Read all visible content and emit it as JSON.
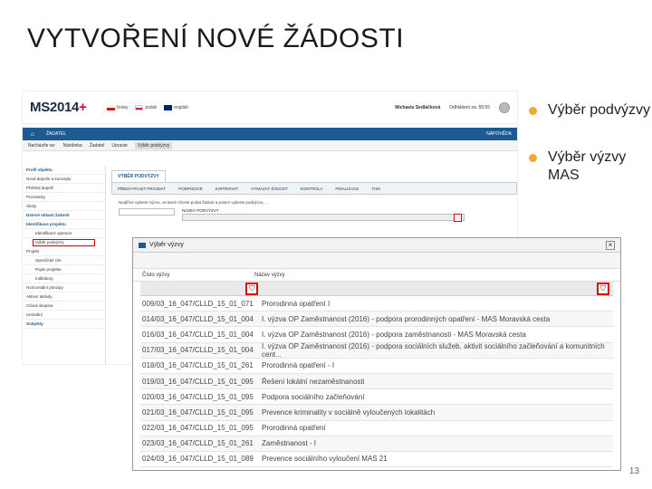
{
  "slide": {
    "title": "VYTVOŘENÍ NOVÉ ŽÁDOSTI",
    "page_number": "13",
    "bullets": [
      "Výběr podvýzvy",
      "Výběr výzvy MAS"
    ]
  },
  "app": {
    "logo_main": "MS2014",
    "logo_plus": "+",
    "languages": [
      "česky",
      "polski",
      "english"
    ],
    "user_name": "Michaela Sedláčková",
    "session_label": "Odhlášení za: 55:55",
    "nav_left": "ŽADATEL",
    "nav_help": "NÁPOVĚDA",
    "breadcrumbs": [
      "Nacházíte se:",
      "Nástěnka",
      "Žadatel",
      "Upravte",
      "Výběr podvýzvy"
    ],
    "sidebar": [
      {
        "label": "Profil objektu",
        "type": "head"
      },
      {
        "label": "Nová depeše a koncepty",
        "type": "item"
      },
      {
        "label": "Přehled depeší",
        "type": "item"
      },
      {
        "label": "Poznámky",
        "type": "item"
      },
      {
        "label": "Úkoly",
        "type": "item"
      },
      {
        "label": "Datové oblasti žádosti",
        "type": "head"
      },
      {
        "label": "Identifikace projektu",
        "type": "head"
      },
      {
        "label": "Identifikace operace",
        "type": "sub"
      },
      {
        "label": "Výběr podvýzvy",
        "type": "active"
      },
      {
        "label": "Projekt",
        "type": "item"
      },
      {
        "label": "Specifické cíle",
        "type": "sub"
      },
      {
        "label": "Popis projektu",
        "type": "sub"
      },
      {
        "label": "Indikátory",
        "type": "sub"
      },
      {
        "label": "Horizontální principy",
        "type": "item"
      },
      {
        "label": "Aktivní aktivity",
        "type": "item"
      },
      {
        "label": "Cílová skupina",
        "type": "item"
      },
      {
        "label": "Umístění",
        "type": "item"
      },
      {
        "label": "Subjekty",
        "type": "head"
      }
    ],
    "content_tab": "VÝBĚR PODVÝZVY",
    "toolbar": [
      "PŘEDVYPLNIT PROJEKT",
      "PODPISOVÉ",
      "KOPÍROVAT",
      "VYMAZAT ŽÁDOST",
      "KONTROLA",
      "FINALIZACE",
      "TISK"
    ],
    "note": "Nejdříve vyberte výzvu, ve které chcete podat žádost a potom vyberte podvýzvu, ...",
    "field_label": "NÁZEV PODVÝZVY"
  },
  "dialog": {
    "title": "Výběr výzvy",
    "close_icon": "close-icon",
    "col1": "Číslo výzvy",
    "col2": "Název výzvy",
    "rows": [
      [
        "009/03_16_047/CLLD_15_01_071",
        "Prorodinná opatření I"
      ],
      [
        "014/03_16_047/CLLD_15_01_004",
        "I. výzva OP Zaměstnanost (2016) - podpora prorodinných opatření - MAS Moravská cesta"
      ],
      [
        "016/03_16_047/CLLD_15_01_004",
        "I. výzva OP Zaměstnanost (2016) - podpora zaměstnanosti - MAS Moravská cesta"
      ],
      [
        "017/03_16_047/CLLD_15_01_004",
        "I. výzva OP Zaměstnanost (2016) - podpora sociálních služeb, aktivit sociálního začleňování a komunitních cent..."
      ],
      [
        "018/03_16_047/CLLD_15_01_261",
        "Prorodinná opatření - I"
      ],
      [
        "019/03_16_047/CLLD_15_01_095",
        "Řešení lokální nezaměstnanosti"
      ],
      [
        "020/03_16_047/CLLD_15_01_095",
        "Podpora sociálního začleňování"
      ],
      [
        "021/03_16_047/CLLD_15_01_095",
        "Prevence kriminality v sociálně vyloučených lokalitách"
      ],
      [
        "022/03_16_047/CLLD_15_01_095",
        "Prorodinná opatření"
      ],
      [
        "023/03_16_047/CLLD_15_01_261",
        "Zaměstnanost - I"
      ],
      [
        "024/03_16_047/CLLD_15_01_089",
        "Prevence sociálního vyloučení MAS 21"
      ]
    ]
  }
}
